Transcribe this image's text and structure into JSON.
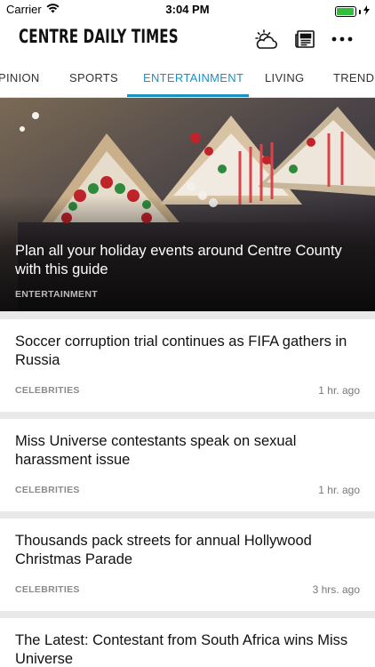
{
  "status_bar": {
    "carrier": "Carrier",
    "time": "3:04 PM",
    "battery_level": 0.95,
    "battery_color": "#2fbf3a"
  },
  "header": {
    "logo": "CENTRE DAILY TIMES",
    "icons": [
      "weather-icon",
      "newspaper-icon",
      "more-icon"
    ]
  },
  "tabs": {
    "items": [
      "PINION",
      "SPORTS",
      "ENTERTAINMENT",
      "LIVING",
      "TRENDIN"
    ],
    "active": "ENTERTAINMENT",
    "accent_color": "#1a92c7"
  },
  "hero": {
    "headline": "Plan all your holiday events around Centre County with this guide",
    "section": "ENTERTAINMENT"
  },
  "stories": [
    {
      "title": "Soccer corruption trial continues as FIFA gathers in Russia",
      "category": "CELEBRITIES",
      "age": "1 hr. ago"
    },
    {
      "title": "Miss Universe contestants speak on sexual harassment issue",
      "category": "CELEBRITIES",
      "age": "1 hr. ago"
    },
    {
      "title": "Thousands pack streets for annual Hollywood Christmas Parade",
      "category": "CELEBRITIES",
      "age": "3 hrs. ago"
    },
    {
      "title": "The Latest: Contestant from South Africa wins Miss Universe",
      "category": "",
      "age": ""
    }
  ]
}
